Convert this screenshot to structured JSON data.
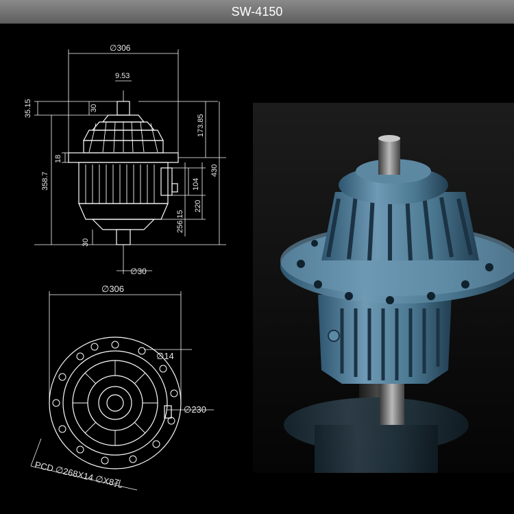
{
  "title": "SW-4150",
  "side_view": {
    "dim_overall_dia": "306",
    "dim_shaft_key": "9.53",
    "dim_top_height": "35.15",
    "dim_shaft_top_len": "30",
    "dim_upper_to_flange": "173.85",
    "dim_body_left": "358.7",
    "dim_flange_thk": "18",
    "dim_total": "430",
    "dim_104": "104",
    "dim_220": "220",
    "dim_256": "256.15",
    "dim_shaft_bot_len": "30",
    "dim_shaft_dia": "30"
  },
  "front_view": {
    "dim_overall_dia": "306",
    "dim_hole_dia": "14",
    "dim_pilot_dia": "230",
    "pcd_note": "PCD ∅268X14 ∅X8孔"
  }
}
